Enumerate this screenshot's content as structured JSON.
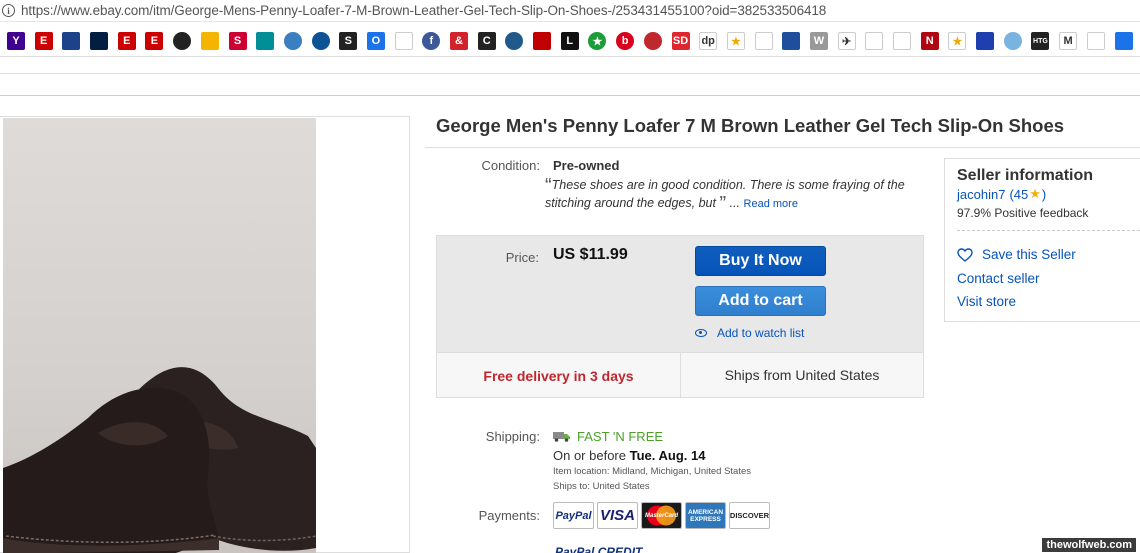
{
  "browser": {
    "url": "https://www.ebay.com/itm/George-Mens-Penny-Loafer-7-M-Brown-Leather-Gel-Tech-Slip-On-Shoes-/253431455100?oid=382533506418",
    "bookmarks": [
      {
        "icon": "yahoo-icon",
        "glyph": "Y",
        "bg": "#400090",
        "round": false
      },
      {
        "icon": "espn-icon",
        "glyph": "E",
        "bg": "#cc0000",
        "round": false
      },
      {
        "icon": "nba-icon",
        "glyph": "",
        "bg": "#1d428a",
        "round": false
      },
      {
        "icon": "mlb-icon",
        "glyph": "",
        "bg": "#041e42",
        "round": false
      },
      {
        "icon": "espn-icon",
        "glyph": "E",
        "bg": "#cc0000",
        "round": false
      },
      {
        "icon": "espn-icon",
        "glyph": "E",
        "bg": "#cc0000",
        "round": false
      },
      {
        "icon": "nhl-icon",
        "glyph": "",
        "bg": "#222222",
        "round": true
      },
      {
        "icon": "nascar-icon",
        "glyph": "",
        "bg": "#f5b400",
        "round": false
      },
      {
        "icon": "ncaa-icon",
        "glyph": "S",
        "bg": "#cc0033",
        "round": false
      },
      {
        "icon": "dolphins-icon",
        "glyph": "",
        "bg": "#008e97",
        "round": false
      },
      {
        "icon": "nbc-icon",
        "glyph": "",
        "bg": "#3a7fc0",
        "round": true
      },
      {
        "icon": "comet-icon",
        "glyph": "",
        "bg": "#0b5394",
        "round": true
      },
      {
        "icon": "s-icon",
        "glyph": "S",
        "bg": "#222222",
        "round": false
      },
      {
        "icon": "o-icon",
        "glyph": "O",
        "bg": "#1a73e8",
        "round": false
      },
      {
        "icon": "page-icon",
        "glyph": "",
        "bg": "#ffffff",
        "round": false
      },
      {
        "icon": "f-icon",
        "glyph": "f",
        "bg": "#3b5998",
        "round": true
      },
      {
        "icon": "ampersand-icon",
        "glyph": "&",
        "bg": "#d2232a",
        "round": false
      },
      {
        "icon": "c-icon",
        "glyph": "C",
        "bg": "#222222",
        "round": false
      },
      {
        "icon": "ajc-icon",
        "glyph": "",
        "bg": "#1f5a8b",
        "round": true
      },
      {
        "icon": "news-icon",
        "glyph": "",
        "bg": "#c00000",
        "round": false
      },
      {
        "icon": "l-icon",
        "glyph": "L",
        "bg": "#111111",
        "round": false
      },
      {
        "icon": "star-circle-icon",
        "glyph": "★",
        "bg": "#1e9c3a",
        "round": true
      },
      {
        "icon": "b-icon",
        "glyph": "b",
        "bg": "#d9001b",
        "round": true
      },
      {
        "icon": "dot-icon",
        "glyph": "",
        "bg": "#c0282d",
        "round": true
      },
      {
        "icon": "sd-icon",
        "glyph": "SD",
        "bg": "#e0262e",
        "round": false
      },
      {
        "icon": "dp-icon",
        "glyph": "dp",
        "bg": "#ffffff",
        "round": false
      },
      {
        "icon": "star-icon",
        "glyph": "★",
        "bg": "#ffffff",
        "round": false
      },
      {
        "icon": "tent-icon",
        "glyph": "",
        "bg": "#ffffff",
        "round": false
      },
      {
        "icon": "weather-icon",
        "glyph": "",
        "bg": "#1f4e9c",
        "round": false
      },
      {
        "icon": "w-icon",
        "glyph": "W",
        "bg": "#999999",
        "round": false
      },
      {
        "icon": "plane-icon",
        "glyph": "✈",
        "bg": "#ffffff",
        "round": false
      },
      {
        "icon": "cat-icon",
        "glyph": "",
        "bg": "#ffffff",
        "round": false
      },
      {
        "icon": "sh-icon",
        "glyph": "",
        "bg": "#ffffff",
        "round": false
      },
      {
        "icon": "netflix-icon",
        "glyph": "N",
        "bg": "#b00610",
        "round": false
      },
      {
        "icon": "star-icon",
        "glyph": "★",
        "bg": "#ffffff",
        "round": false
      },
      {
        "icon": "flag-icon",
        "glyph": "",
        "bg": "#1e3fae",
        "round": false
      },
      {
        "icon": "globe-icon",
        "glyph": "",
        "bg": "#79b4e0",
        "round": true
      },
      {
        "icon": "htg-icon",
        "glyph": "HTG",
        "bg": "#222222",
        "round": false
      },
      {
        "icon": "gmail-icon",
        "glyph": "M",
        "bg": "#ffffff",
        "round": false
      },
      {
        "icon": "drive-icon",
        "glyph": "",
        "bg": "#ffffff",
        "round": false
      },
      {
        "icon": "calendar-icon",
        "glyph": "",
        "bg": "#1a73e8",
        "round": false
      }
    ]
  },
  "listing": {
    "title": "George Men's Penny Loafer 7 M Brown Leather Gel Tech Slip-On Shoes",
    "condition_label": "Condition:",
    "condition_value": "Pre-owned",
    "condition_note": "These shoes are in good condition. There is some fraying of the stitching around the edges, but",
    "condition_more": "...",
    "read_more": "Read more",
    "price_label": "Price:",
    "price": "US $11.99",
    "buy_now": "Buy It Now",
    "add_to_cart": "Add to cart",
    "watch": "Add to watch list",
    "free_delivery": "Free delivery in 3 days",
    "ships_from": "Ships from United States",
    "shipping_label": "Shipping:",
    "shipping_method": "FAST 'N FREE",
    "ship_date_prefix": "On or before",
    "ship_date": "Tue. Aug. 14",
    "item_location": "Item location:  Midland, Michigan, United States",
    "ships_to": "Ships to:  United States",
    "payments_label": "Payments:",
    "payment_methods": [
      "PayPal",
      "VISA",
      "MasterCard",
      "AMERICAN EXPRESS",
      "DISCOVER"
    ],
    "paypal_credit": "PayPal CREDIT"
  },
  "seller": {
    "title": "Seller information",
    "name": "jacohin7",
    "score_open": "(45",
    "score_close": ")",
    "feedback": "97.9% Positive feedback",
    "save": "Save this Seller",
    "contact": "Contact seller",
    "store": "Visit store"
  },
  "watermark": "thewolfweb.com",
  "colors": {
    "link": "#0654ba",
    "buy_now": "#0654ba",
    "add_to_cart": "#3185d6",
    "delivery": "#c1262e",
    "fast_free": "#4ba02a"
  }
}
